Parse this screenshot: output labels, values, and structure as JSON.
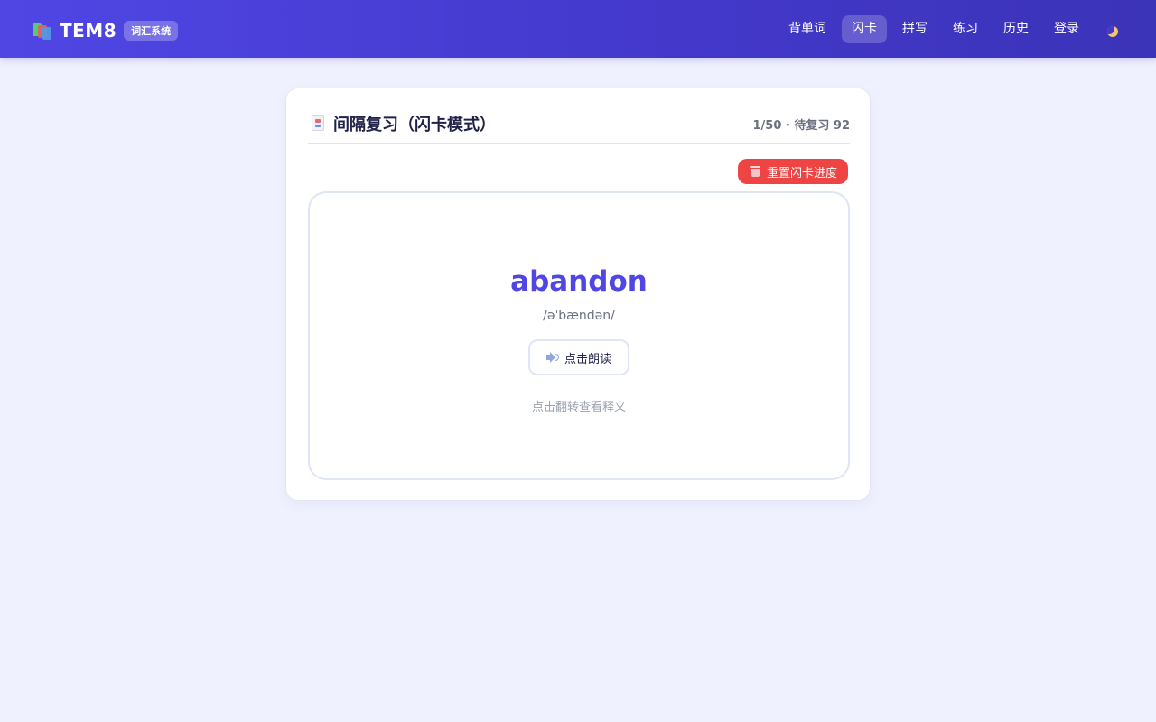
{
  "header": {
    "brand": "TEM8",
    "badge": "词汇系统",
    "nav": [
      {
        "label": "背单词"
      },
      {
        "label": "闪卡",
        "active": true
      },
      {
        "label": "拼写"
      },
      {
        "label": "练习"
      },
      {
        "label": "历史"
      },
      {
        "label": "登录"
      }
    ],
    "theme_icon": "moon-icon"
  },
  "panel": {
    "title": "间隔复习（闪卡模式）",
    "stats": "1/50 · 待复习 92",
    "reset_label": "重置闪卡进度",
    "card": {
      "word": "abandon",
      "phonetic": "/əˈbændən/",
      "speak_label": "点击朗读",
      "flip_hint": "点击翻转查看释义"
    }
  },
  "colors": {
    "primary": "#4f46e5",
    "nav_gradient_start": "#5046e4",
    "nav_gradient_end": "#3b33b8",
    "danger": "#ef4444",
    "background": "#eff1fe"
  }
}
